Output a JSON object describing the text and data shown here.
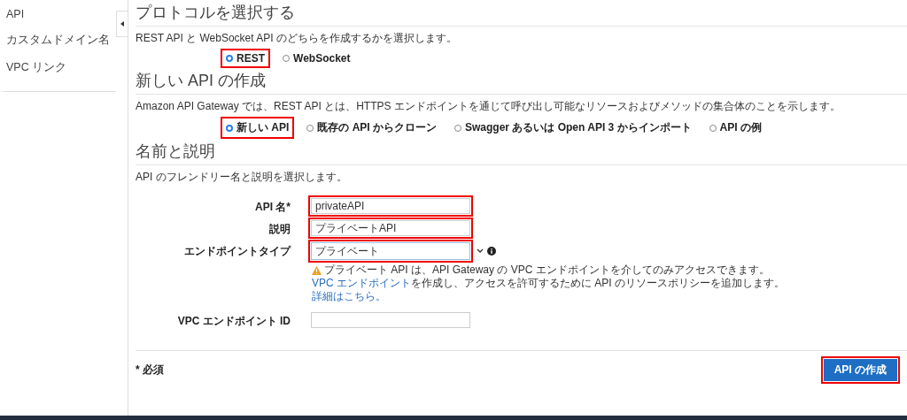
{
  "sidebar": {
    "items": [
      {
        "label": "API"
      },
      {
        "label": "カスタムドメイン名"
      },
      {
        "label": "VPC リンク"
      }
    ]
  },
  "protocol": {
    "title": "プロトコルを選択する",
    "description": "REST API と WebSocket API のどちらを作成するかを選択します。",
    "options": [
      {
        "label": "REST",
        "selected": true,
        "highlighted": true
      },
      {
        "label": "WebSocket",
        "selected": false,
        "highlighted": false
      }
    ]
  },
  "new_api": {
    "title": "新しい API の作成",
    "description": "Amazon API Gateway では、REST API とは、HTTPS エンドポイントを通じて呼び出し可能なリソースおよびメソッドの集合体のことを示します。",
    "options": [
      {
        "label": "新しい API",
        "selected": true,
        "highlighted": true
      },
      {
        "label": "既存の API からクローン",
        "selected": false,
        "highlighted": false
      },
      {
        "label": "Swagger あるいは Open API 3 からインポート",
        "selected": false,
        "highlighted": false
      },
      {
        "label": "API の例",
        "selected": false,
        "highlighted": false
      }
    ]
  },
  "name_section": {
    "title": "名前と説明",
    "description": "API のフレンドリー名と説明を選択します。",
    "fields": [
      {
        "kind": "text",
        "label": "API 名*",
        "value": "privateAPI",
        "highlighted": true
      },
      {
        "kind": "text",
        "label": "説明",
        "value": "プライベートAPI",
        "highlighted": true
      },
      {
        "kind": "select",
        "label": "エンドポイントタイプ",
        "value": "プライベート",
        "highlighted": true,
        "warning": "プライベート API は、API Gateway の VPC エンドポイントを介してのみアクセスできます。",
        "link": "VPC エンドポイント",
        "link_suffix": "を作成し、アクセスを許可するために API のリソースポリシーを追加します。",
        "more_link": "詳細はこちら。"
      },
      {
        "kind": "text",
        "label": "VPC エンドポイント ID",
        "highlighted": false
      }
    ]
  },
  "footer": {
    "required_note": "* 必須",
    "create_button": {
      "label": "API の作成",
      "highlighted": true
    }
  }
}
